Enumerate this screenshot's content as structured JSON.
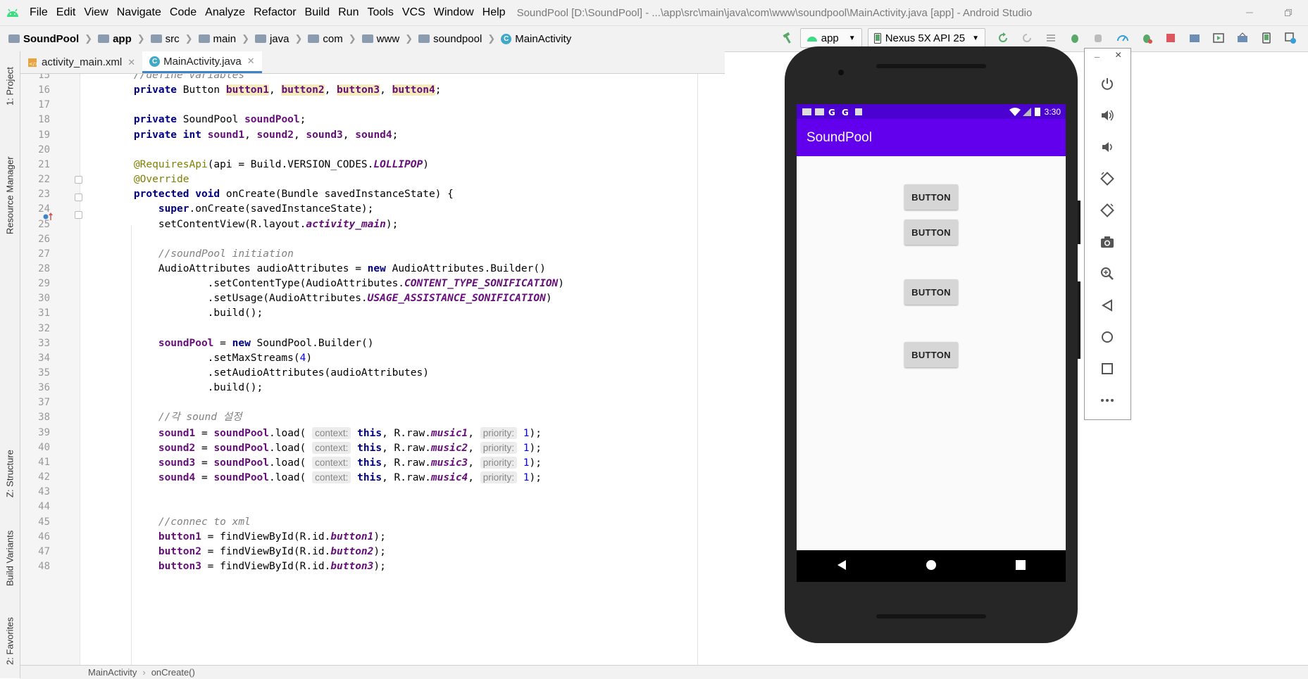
{
  "menubar": {
    "items": [
      "File",
      "Edit",
      "View",
      "Navigate",
      "Code",
      "Analyze",
      "Refactor",
      "Build",
      "Run",
      "Tools",
      "VCS",
      "Window",
      "Help"
    ],
    "title": "SoundPool [D:\\SoundPool] - ...\\app\\src\\main\\java\\com\\www\\soundpool\\MainActivity.java [app] - Android Studio"
  },
  "breadcrumb": [
    "SoundPool",
    "app",
    "src",
    "main",
    "java",
    "com",
    "www",
    "soundpool",
    "MainActivity"
  ],
  "toolbar": {
    "run_config": "app",
    "device": "Nexus 5X API 25"
  },
  "side_tabs": [
    "1: Project",
    "Resource Manager",
    "Z: Structure",
    "Build Variants",
    "2: Favorites"
  ],
  "tabs": [
    {
      "label": "activity_main.xml",
      "active": false
    },
    {
      "label": "MainActivity.java",
      "active": true
    }
  ],
  "code": {
    "first_line": 15,
    "lines": [
      [
        {
          "t": "    //define variables",
          "c": "cmt"
        }
      ],
      [
        {
          "t": "    "
        },
        {
          "t": "private",
          "c": "kw"
        },
        {
          "t": " Button "
        },
        {
          "t": "button1",
          "c": "fld hl"
        },
        {
          "t": ", "
        },
        {
          "t": "button2",
          "c": "fld hl"
        },
        {
          "t": ", "
        },
        {
          "t": "button3",
          "c": "fld hl"
        },
        {
          "t": ", "
        },
        {
          "t": "button4",
          "c": "fld hl"
        },
        {
          "t": ";"
        }
      ],
      [],
      [
        {
          "t": "    "
        },
        {
          "t": "private",
          "c": "kw"
        },
        {
          "t": " SoundPool "
        },
        {
          "t": "soundPool",
          "c": "fld"
        },
        {
          "t": ";"
        }
      ],
      [
        {
          "t": "    "
        },
        {
          "t": "private int",
          "c": "kw"
        },
        {
          "t": " "
        },
        {
          "t": "sound1",
          "c": "fld"
        },
        {
          "t": ", "
        },
        {
          "t": "sound2",
          "c": "fld"
        },
        {
          "t": ", "
        },
        {
          "t": "sound3",
          "c": "fld"
        },
        {
          "t": ", "
        },
        {
          "t": "sound4",
          "c": "fld"
        },
        {
          "t": ";"
        }
      ],
      [],
      [
        {
          "t": "    "
        },
        {
          "t": "@RequiresApi",
          "c": "ann"
        },
        {
          "t": "(api = Build.VERSION_CODES."
        },
        {
          "t": "LOLLIPOP",
          "c": "cst"
        },
        {
          "t": ")"
        }
      ],
      [
        {
          "t": "    "
        },
        {
          "t": "@Override",
          "c": "ann"
        }
      ],
      [
        {
          "t": "    "
        },
        {
          "t": "protected void",
          "c": "kw"
        },
        {
          "t": " onCreate(Bundle savedInstanceState) {"
        }
      ],
      [
        {
          "t": "        "
        },
        {
          "t": "super",
          "c": "kw"
        },
        {
          "t": ".onCreate(savedInstanceState);"
        }
      ],
      [
        {
          "t": "        setContentView(R.layout."
        },
        {
          "t": "activity_main",
          "c": "cst"
        },
        {
          "t": ");"
        }
      ],
      [],
      [
        {
          "t": "        //soundPool initiation",
          "c": "cmt"
        }
      ],
      [
        {
          "t": "        AudioAttributes audioAttributes = "
        },
        {
          "t": "new",
          "c": "kw"
        },
        {
          "t": " AudioAttributes.Builder()"
        }
      ],
      [
        {
          "t": "                .setContentType(AudioAttributes."
        },
        {
          "t": "CONTENT_TYPE_SONIFICATION",
          "c": "cst"
        },
        {
          "t": ")"
        }
      ],
      [
        {
          "t": "                .setUsage(AudioAttributes."
        },
        {
          "t": "USAGE_ASSISTANCE_SONIFICATION",
          "c": "cst"
        },
        {
          "t": ")"
        }
      ],
      [
        {
          "t": "                .build();"
        }
      ],
      [],
      [
        {
          "t": "        "
        },
        {
          "t": "soundPool",
          "c": "fld"
        },
        {
          "t": " = "
        },
        {
          "t": "new",
          "c": "kw"
        },
        {
          "t": " SoundPool.Builder()"
        }
      ],
      [
        {
          "t": "                .setMaxStreams("
        },
        {
          "t": "4",
          "c": "num"
        },
        {
          "t": ")"
        }
      ],
      [
        {
          "t": "                .setAudioAttributes(audioAttributes)"
        }
      ],
      [
        {
          "t": "                .build();"
        }
      ],
      [],
      [
        {
          "t": "        //각 sound 설정",
          "c": "cmt"
        }
      ],
      [
        {
          "t": "        "
        },
        {
          "t": "sound1",
          "c": "fld"
        },
        {
          "t": " = "
        },
        {
          "t": "soundPool",
          "c": "fld"
        },
        {
          "t": ".load( "
        },
        {
          "t": "context:",
          "c": "hint"
        },
        {
          "t": " "
        },
        {
          "t": "this",
          "c": "kw"
        },
        {
          "t": ", R.raw."
        },
        {
          "t": "music1",
          "c": "cst"
        },
        {
          "t": ", "
        },
        {
          "t": "priority:",
          "c": "hint"
        },
        {
          "t": " "
        },
        {
          "t": "1",
          "c": "num"
        },
        {
          "t": ");"
        }
      ],
      [
        {
          "t": "        "
        },
        {
          "t": "sound2",
          "c": "fld"
        },
        {
          "t": " = "
        },
        {
          "t": "soundPool",
          "c": "fld"
        },
        {
          "t": ".load( "
        },
        {
          "t": "context:",
          "c": "hint"
        },
        {
          "t": " "
        },
        {
          "t": "this",
          "c": "kw"
        },
        {
          "t": ", R.raw."
        },
        {
          "t": "music2",
          "c": "cst"
        },
        {
          "t": ", "
        },
        {
          "t": "priority:",
          "c": "hint"
        },
        {
          "t": " "
        },
        {
          "t": "1",
          "c": "num"
        },
        {
          "t": ");"
        }
      ],
      [
        {
          "t": "        "
        },
        {
          "t": "sound3",
          "c": "fld"
        },
        {
          "t": " = "
        },
        {
          "t": "soundPool",
          "c": "fld"
        },
        {
          "t": ".load( "
        },
        {
          "t": "context:",
          "c": "hint"
        },
        {
          "t": " "
        },
        {
          "t": "this",
          "c": "kw"
        },
        {
          "t": ", R.raw."
        },
        {
          "t": "music3",
          "c": "cst"
        },
        {
          "t": ", "
        },
        {
          "t": "priority:",
          "c": "hint"
        },
        {
          "t": " "
        },
        {
          "t": "1",
          "c": "num"
        },
        {
          "t": ");"
        }
      ],
      [
        {
          "t": "        "
        },
        {
          "t": "sound4",
          "c": "fld"
        },
        {
          "t": " = "
        },
        {
          "t": "soundPool",
          "c": "fld"
        },
        {
          "t": ".load( "
        },
        {
          "t": "context:",
          "c": "hint"
        },
        {
          "t": " "
        },
        {
          "t": "this",
          "c": "kw"
        },
        {
          "t": ", R.raw."
        },
        {
          "t": "music4",
          "c": "cst"
        },
        {
          "t": ", "
        },
        {
          "t": "priority:",
          "c": "hint"
        },
        {
          "t": " "
        },
        {
          "t": "1",
          "c": "num"
        },
        {
          "t": ");"
        }
      ],
      [],
      [],
      [
        {
          "t": "        //connec to xml",
          "c": "cmt"
        }
      ],
      [
        {
          "t": "        "
        },
        {
          "t": "button1",
          "c": "fld"
        },
        {
          "t": " = findViewById(R.id."
        },
        {
          "t": "button1",
          "c": "cst"
        },
        {
          "t": ");"
        }
      ],
      [
        {
          "t": "        "
        },
        {
          "t": "button2",
          "c": "fld"
        },
        {
          "t": " = findViewById(R.id."
        },
        {
          "t": "button2",
          "c": "cst"
        },
        {
          "t": ");"
        }
      ],
      [
        {
          "t": "        "
        },
        {
          "t": "button3",
          "c": "fld"
        },
        {
          "t": " = findViewById(R.id."
        },
        {
          "t": "button3",
          "c": "cst"
        },
        {
          "t": ");"
        }
      ]
    ]
  },
  "statusbar": {
    "class_name": "MainActivity",
    "separator": "›",
    "method_name": "onCreate()"
  },
  "emulator": {
    "clock": "3:30",
    "app_title": "SoundPool",
    "buttons": [
      "BUTTON",
      "BUTTON",
      "BUTTON",
      "BUTTON"
    ],
    "panel_minimize": "–",
    "panel_close": "×",
    "tools": [
      "power-icon",
      "volume-up-icon",
      "volume-down-icon",
      "rotate-left-icon",
      "rotate-right-icon",
      "camera-icon",
      "zoom-icon",
      "back-icon",
      "home-icon",
      "overview-icon",
      "more-icon"
    ]
  }
}
